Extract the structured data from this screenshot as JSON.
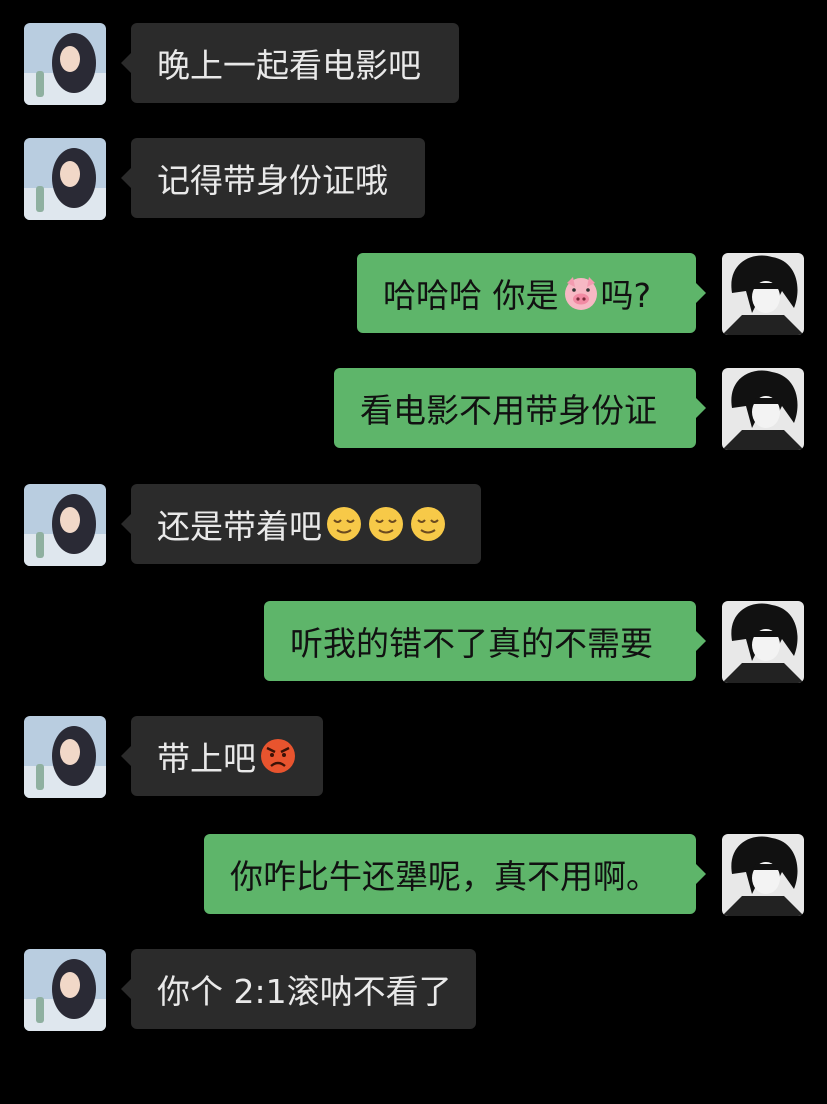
{
  "messages": [
    {
      "side": "left",
      "text": "晚上一起看电影吧",
      "emojis": []
    },
    {
      "side": "left",
      "text": "记得带身份证哦",
      "emojis": []
    },
    {
      "side": "right",
      "text": "哈哈哈 你是",
      "emojis": [
        "pig-face"
      ],
      "suffix": "吗?"
    },
    {
      "side": "right",
      "text": "看电影不用带身份证",
      "emojis": []
    },
    {
      "side": "left",
      "text": "还是带着吧",
      "emojis": [
        "relieved-face",
        "relieved-face",
        "relieved-face"
      ]
    },
    {
      "side": "right",
      "text": "听我的错不了真的不需要",
      "emojis": []
    },
    {
      "side": "left",
      "text": "带上吧",
      "emojis": [
        "angry-face"
      ]
    },
    {
      "side": "right",
      "text": "你咋比牛还犟呢，真不用啊。",
      "emojis": []
    },
    {
      "side": "left",
      "text": "你个 2:1滚呐不看了",
      "emojis": []
    }
  ],
  "colors": {
    "background": "#000000",
    "left_bubble": "#2b2b2b",
    "right_bubble": "#5eb56a"
  }
}
